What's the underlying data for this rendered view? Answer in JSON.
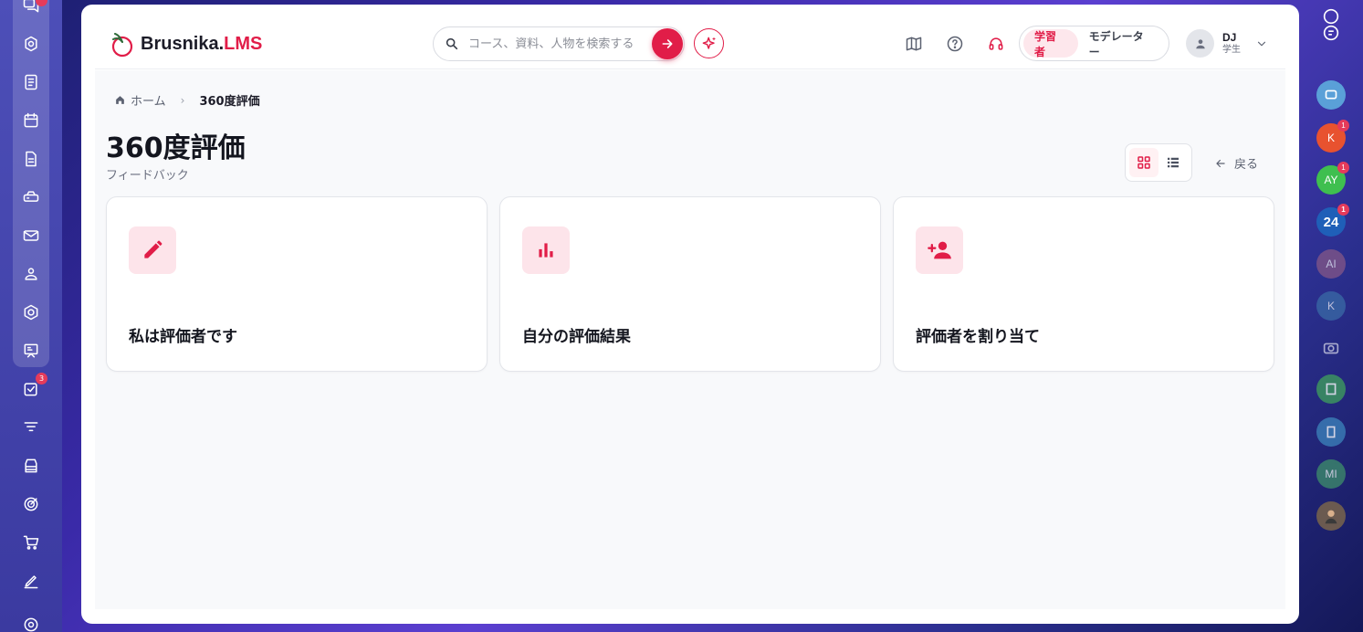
{
  "app": {
    "brand_main": "Brusnika.",
    "brand_accent": "LMS",
    "accent_color": "#e11d48"
  },
  "left_rail": {
    "items": [
      {
        "icon": "chat-bubbles-icon",
        "badge": ""
      },
      {
        "icon": "gear-cog-icon",
        "badge": ""
      },
      {
        "icon": "notebook-icon",
        "badge": ""
      },
      {
        "icon": "calendar-icon",
        "badge": ""
      },
      {
        "icon": "document-icon",
        "badge": ""
      },
      {
        "icon": "card-reader-icon",
        "badge": ""
      },
      {
        "icon": "mail-icon",
        "badge": ""
      },
      {
        "icon": "group-users-icon",
        "badge": ""
      },
      {
        "icon": "hexagon-icon",
        "badge": ""
      },
      {
        "icon": "presentation-board-icon",
        "badge": ""
      },
      {
        "icon": "task-checkbox-icon",
        "badge": "3"
      },
      {
        "icon": "funnel-icon",
        "badge": ""
      },
      {
        "icon": "archive-box-icon",
        "badge": ""
      },
      {
        "icon": "target-icon",
        "badge": ""
      },
      {
        "icon": "shopping-cart-icon",
        "badge": ""
      },
      {
        "icon": "pen-edit-icon",
        "badge": ""
      },
      {
        "icon": "settings-icon",
        "badge": ""
      }
    ]
  },
  "right_rail": {
    "avatars": [
      {
        "initials": "K",
        "color": "#e8522f",
        "badge": "1"
      },
      {
        "initials": "AY",
        "color": "#3fbf4f",
        "badge": "1"
      },
      {
        "initials": "24",
        "color": "#1f5fb8",
        "badge": "1"
      },
      {
        "initials": "AI",
        "color": "#8b5a86",
        "badge": ""
      },
      {
        "initials": "K",
        "color": "#3b6fa8",
        "badge": ""
      },
      {
        "initials": "MI",
        "color": "#3e8f6a",
        "badge": ""
      }
    ]
  },
  "header": {
    "search_placeholder": "コース、資料、人物を検索する",
    "role_learner": "学習者",
    "role_moderator": "モデレーター",
    "user_initials": "DJ",
    "user_role": "学生"
  },
  "breadcrumb": {
    "home": "ホーム",
    "separator": "›",
    "current": "360度評価"
  },
  "page": {
    "title": "360度評価",
    "subtitle": "フィードバック",
    "back_label": "戻る"
  },
  "cards": [
    {
      "icon": "pencil-icon",
      "title": "私は評価者です"
    },
    {
      "icon": "bar-chart-icon",
      "title": "自分の評価結果"
    },
    {
      "icon": "add-person-icon",
      "title": "評価者を割り当て"
    }
  ]
}
